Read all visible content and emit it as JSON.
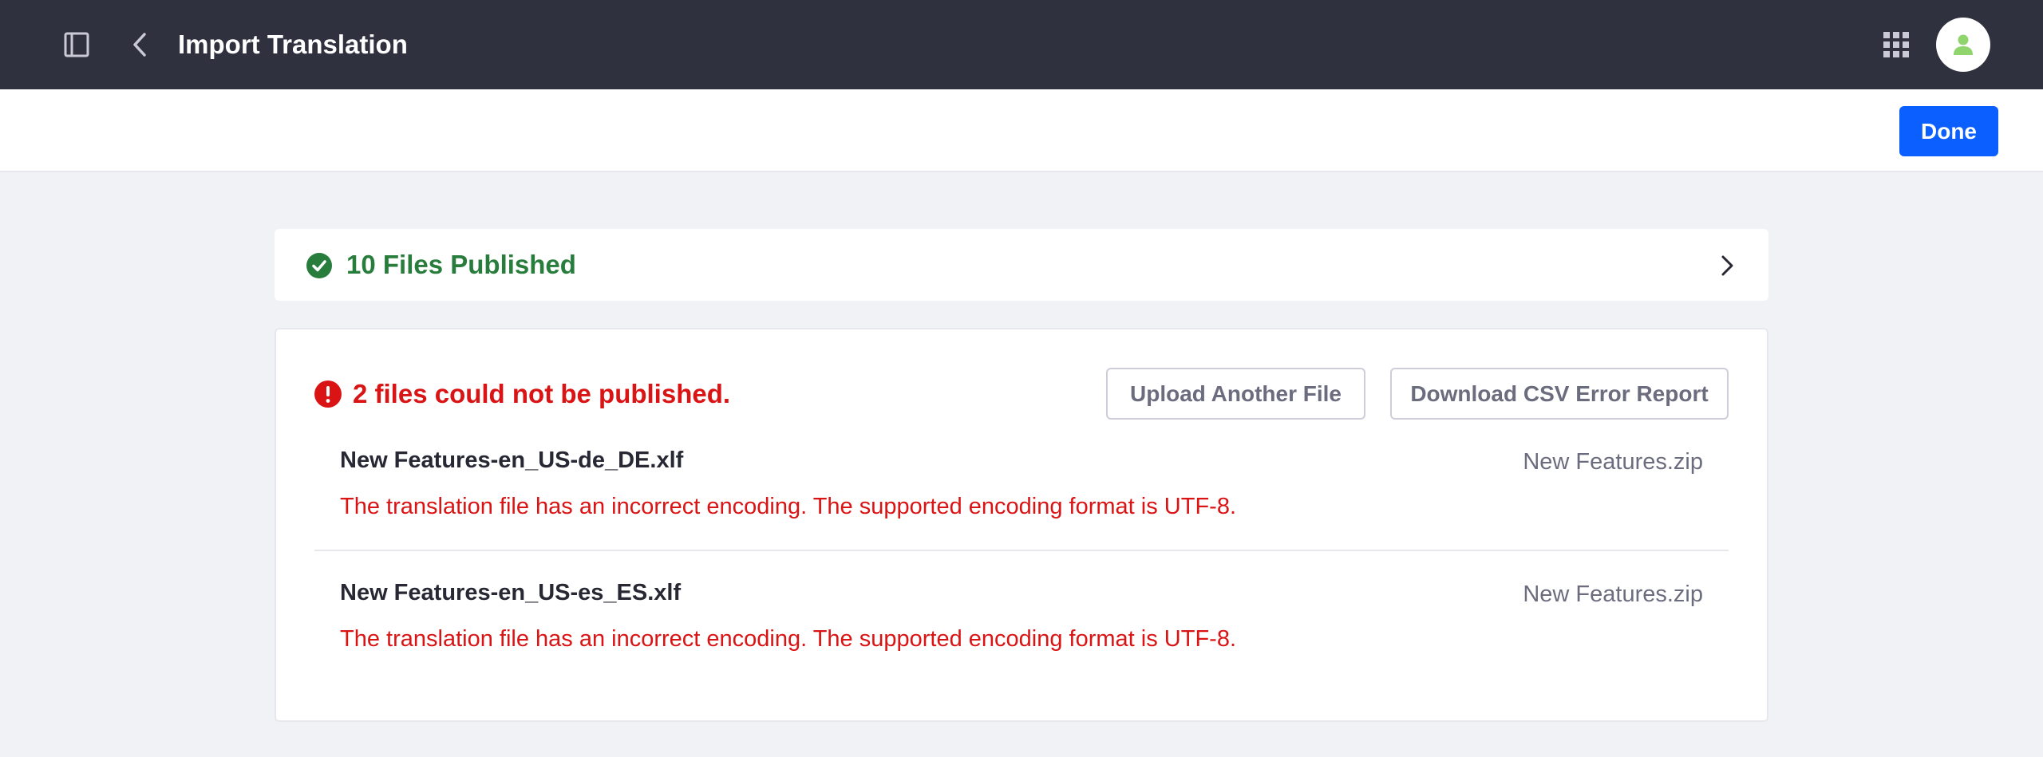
{
  "header": {
    "title": "Import Translation",
    "sidebar_toggle_icon": "sidebar-panel-icon",
    "back_icon": "chevron-left-icon",
    "apps_icon": "grid-apps-icon",
    "avatar_icon": "user-avatar-icon"
  },
  "toolbar": {
    "done_label": "Done"
  },
  "success_panel": {
    "label": "10 Files Published",
    "icon": "check-circle-icon",
    "expand_icon": "chevron-right-icon"
  },
  "error_panel": {
    "title": "2 files could not be published.",
    "icon": "exclamation-circle-icon",
    "upload_label": "Upload Another File",
    "download_label": "Download CSV Error Report",
    "files": [
      {
        "name": "New Features-en_US-de_DE.xlf",
        "source": "New Features.zip",
        "message": "The translation file has an incorrect encoding. The supported encoding format is UTF-8."
      },
      {
        "name": "New Features-en_US-es_ES.xlf",
        "source": "New Features.zip",
        "message": "The translation file has an incorrect encoding. The supported encoding format is UTF-8."
      }
    ]
  },
  "colors": {
    "topbar": "#30313f",
    "primary": "#0b5fff",
    "success": "#287d3c",
    "error": "#da1414",
    "avatar_accent": "#8fd46d"
  }
}
